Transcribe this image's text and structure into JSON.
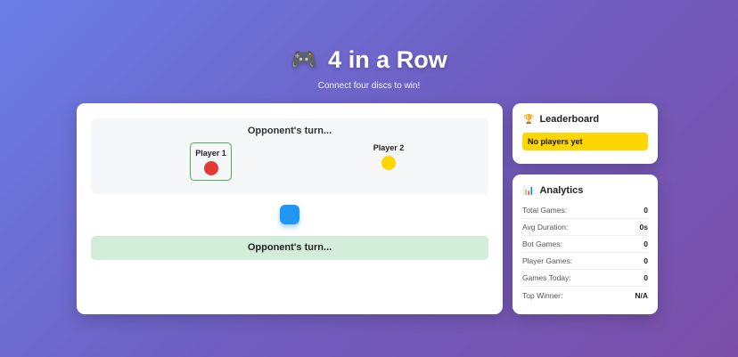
{
  "header": {
    "icon": "🎮",
    "title": "4 in a Row",
    "subtitle": "Connect four discs to win!"
  },
  "game": {
    "status": "Opponent's turn...",
    "player1": {
      "name": "Player 1",
      "color": "#e53935"
    },
    "player2": {
      "name": "Player 2",
      "color": "#ffd600"
    },
    "message": "Opponent's turn..."
  },
  "leaderboard": {
    "icon": "🏆",
    "title": "Leaderboard",
    "empty_text": "No players yet"
  },
  "analytics": {
    "icon": "📊",
    "title": "Analytics",
    "rows": [
      {
        "label": "Total Games:",
        "value": "0"
      },
      {
        "label": "Avg Duration:",
        "value": "0s"
      },
      {
        "label": "Bot Games:",
        "value": "0"
      },
      {
        "label": "Player Games:",
        "value": "0"
      },
      {
        "label": "Games Today:",
        "value": "0"
      },
      {
        "label": "Top Winner:",
        "value": "N/A"
      }
    ]
  },
  "colors": {
    "accent_blue": "#2196f3",
    "active_border": "#4caf50",
    "message_bg": "#d4edda",
    "leaderboard_badge": "#ffd600"
  }
}
